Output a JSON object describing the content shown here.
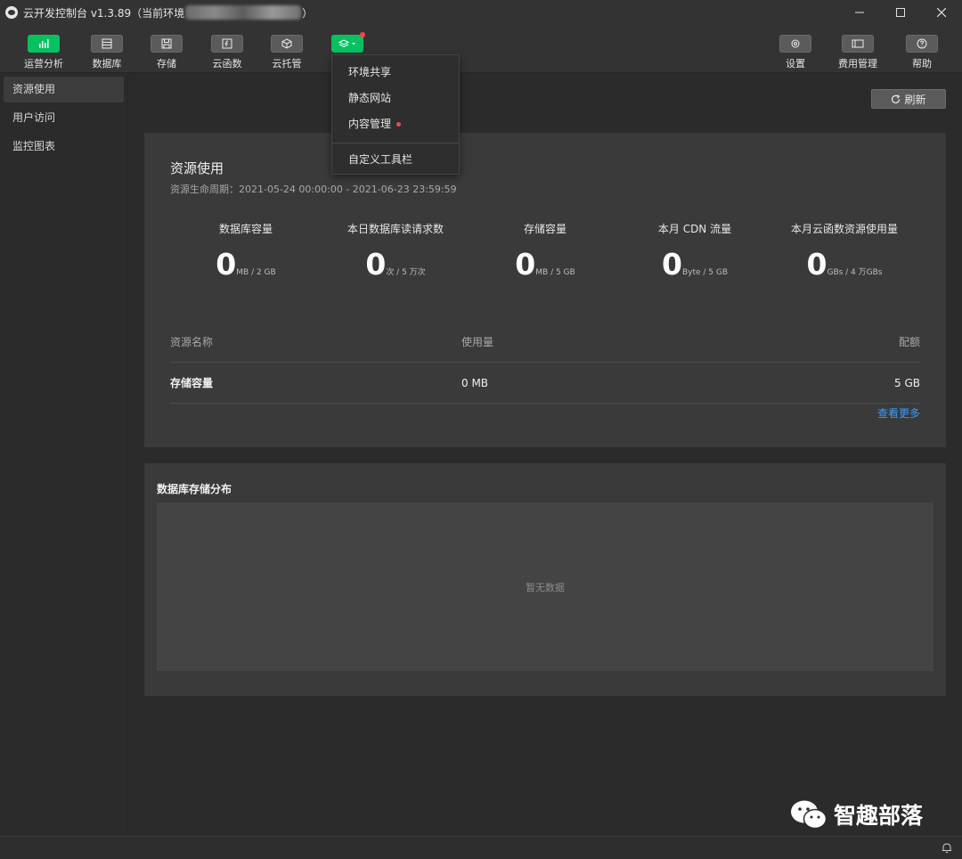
{
  "window": {
    "title_prefix": "云开发控制台 v1.3.89（当前环境",
    "title_suffix": "）",
    "controls": [
      "—",
      "☐",
      "✕"
    ]
  },
  "toolbar": {
    "left": [
      {
        "id": "analytics",
        "label": "运营分析",
        "icon": "bar-chart-icon",
        "active": true
      },
      {
        "id": "database",
        "label": "数据库",
        "icon": "database-icon",
        "active": false
      },
      {
        "id": "storage",
        "label": "存储",
        "icon": "save-icon",
        "active": false
      },
      {
        "id": "functions",
        "label": "云函数",
        "icon": "function-icon",
        "active": false
      },
      {
        "id": "hosting",
        "label": "云托管",
        "icon": "cube-icon",
        "active": false
      },
      {
        "id": "extensions",
        "label": "",
        "icon": "layers-icon",
        "active": true
      }
    ],
    "right": [
      {
        "id": "settings",
        "label": "设置",
        "icon": "gear-icon"
      },
      {
        "id": "billing",
        "label": "费用管理",
        "icon": "card-icon"
      },
      {
        "id": "help",
        "label": "帮助",
        "icon": "help-icon"
      }
    ]
  },
  "dropdown": {
    "items": [
      "环境共享",
      "静态网站",
      "内容管理"
    ],
    "custom": "自定义工具栏"
  },
  "sidebar": {
    "items": [
      {
        "label": "资源使用",
        "active": true
      },
      {
        "label": "用户访问",
        "active": false
      },
      {
        "label": "监控图表",
        "active": false
      }
    ]
  },
  "main": {
    "refresh_label": "刷新",
    "usage": {
      "title": "资源使用",
      "period": "资源生命周期：2021-05-24 00:00:00 - 2021-06-23 23:59:59",
      "metrics": [
        {
          "label": "数据库容量",
          "value": "0",
          "unit": "MB / 2 GB"
        },
        {
          "label": "本日数据库读请求数",
          "value": "0",
          "unit": "次 / 5 万次"
        },
        {
          "label": "存储容量",
          "value": "0",
          "unit": "MB / 5 GB"
        },
        {
          "label": "本月 CDN 流量",
          "value": "0",
          "unit": "Byte / 5 GB"
        },
        {
          "label": "本月云函数资源使用量",
          "value": "0",
          "unit": "GBs / 4 万GBs"
        }
      ],
      "table": {
        "columns": [
          "资源名称",
          "使用量",
          "配额"
        ],
        "rows": [
          [
            "存储容量",
            "0 MB",
            "5 GB"
          ]
        ]
      },
      "more_link": "查看更多"
    },
    "db_distribution": {
      "title": "数据库存储分布",
      "empty_text": "暂无数据"
    }
  },
  "watermark": {
    "text": "智趣部落"
  },
  "colors": {
    "accent": "#07c160",
    "link": "#3a9bff",
    "badge": "#f0454f"
  }
}
